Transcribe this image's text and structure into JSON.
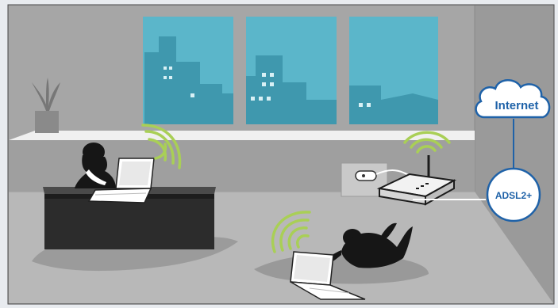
{
  "labels": {
    "internet": "Internet",
    "adsl": "ADSL2+"
  },
  "colors": {
    "wall": "#a8a8a8",
    "floor": "#b9b9b9",
    "sill": "#f2f2f2",
    "window_sky": "#5ab6c9",
    "buildings": "#3e97ad",
    "desk": "#2a2a2a",
    "person": "#161616",
    "laptop": "#ffffff",
    "router": "#e9e9e9",
    "wifi": "#a9cf56",
    "connector": "#1f62a8",
    "cloud_stroke": "#1f62a8"
  },
  "icons": [
    "plant-icon",
    "person-at-desk-icon",
    "laptop-icon",
    "person-lying-icon",
    "router-icon",
    "power-outlet-icon",
    "cloud-icon",
    "wifi-signal-icon"
  ]
}
